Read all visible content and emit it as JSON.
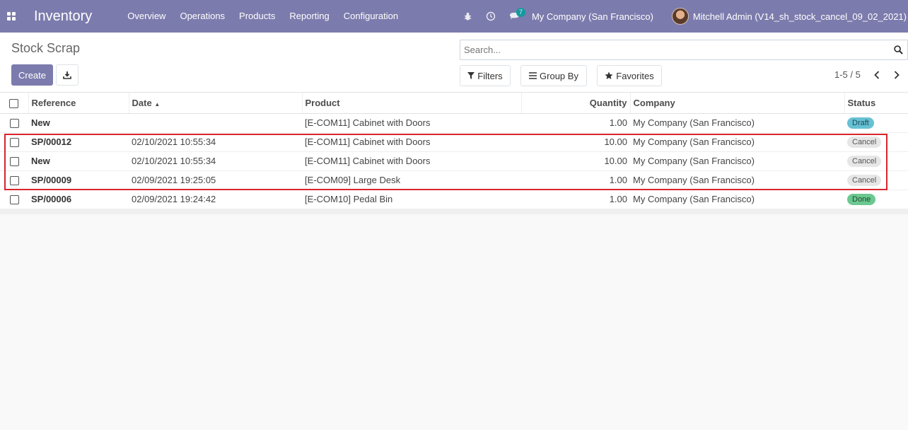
{
  "navbar": {
    "app_name": "Inventory",
    "menu": [
      "Overview",
      "Operations",
      "Products",
      "Reporting",
      "Configuration"
    ],
    "messages_count": "7",
    "company": "My Company (San Francisco)",
    "user": "Mitchell Admin (V14_sh_stock_cancel_09_02_2021)"
  },
  "control": {
    "title": "Stock Scrap",
    "create_label": "Create",
    "search_placeholder": "Search...",
    "filters_label": "Filters",
    "groupby_label": "Group By",
    "favorites_label": "Favorites",
    "pager": "1-5 / 5"
  },
  "table": {
    "columns": [
      "Reference",
      "Date",
      "Product",
      "Quantity",
      "Company",
      "Status"
    ],
    "rows": [
      {
        "reference": "New",
        "date": "",
        "product": "[E-COM11] Cabinet with Doors",
        "quantity": "1.00",
        "company": "My Company (San Francisco)",
        "status": "Draft",
        "status_kind": "draft"
      },
      {
        "reference": "SP/00012",
        "date": "02/10/2021 10:55:34",
        "product": "[E-COM11] Cabinet with Doors",
        "quantity": "10.00",
        "company": "My Company (San Francisco)",
        "status": "Cancel",
        "status_kind": "cancel"
      },
      {
        "reference": "New",
        "date": "02/10/2021 10:55:34",
        "product": "[E-COM11] Cabinet with Doors",
        "quantity": "10.00",
        "company": "My Company (San Francisco)",
        "status": "Cancel",
        "status_kind": "cancel"
      },
      {
        "reference": "SP/00009",
        "date": "02/09/2021 19:25:05",
        "product": "[E-COM09] Large Desk",
        "quantity": "1.00",
        "company": "My Company (San Francisco)",
        "status": "Cancel",
        "status_kind": "cancel"
      },
      {
        "reference": "SP/00006",
        "date": "02/09/2021 19:24:42",
        "product": "[E-COM10] Pedal Bin",
        "quantity": "1.00",
        "company": "My Company (San Francisco)",
        "status": "Done",
        "status_kind": "done"
      }
    ]
  },
  "colors": {
    "brand": "#7c7bad",
    "highlight": "#d9242c"
  }
}
